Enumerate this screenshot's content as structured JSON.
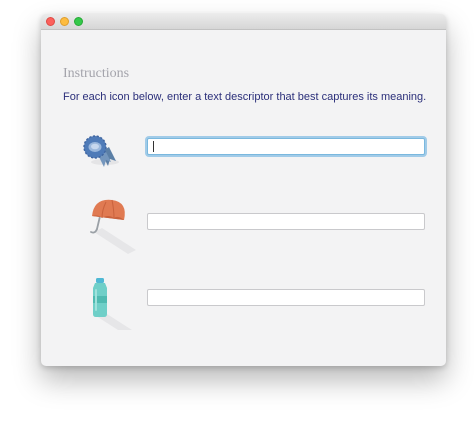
{
  "window": {
    "controls": {
      "close_color": "#fc605c",
      "minimize_color": "#fdbc40",
      "maximize_color": "#34c84a"
    }
  },
  "form": {
    "heading": "Instructions",
    "instructions": "For each icon below, enter a text descriptor that best captures its meaning.",
    "items": [
      {
        "icon": "award-ribbon-icon",
        "value": "",
        "placeholder": "",
        "focused": true
      },
      {
        "icon": "umbrella-icon",
        "value": "",
        "placeholder": "",
        "focused": false
      },
      {
        "icon": "water-bottle-icon",
        "value": "",
        "placeholder": "",
        "focused": false
      }
    ]
  },
  "colors": {
    "window_background": "#f3f3f4",
    "heading_text": "#a3a3ab",
    "instructions_text": "#2b2f7a",
    "focus_ring": "#5daade",
    "ribbon_blue": "#4f7bb8",
    "umbrella_orange": "#e07a52",
    "bottle_teal": "#6fcfc8"
  }
}
